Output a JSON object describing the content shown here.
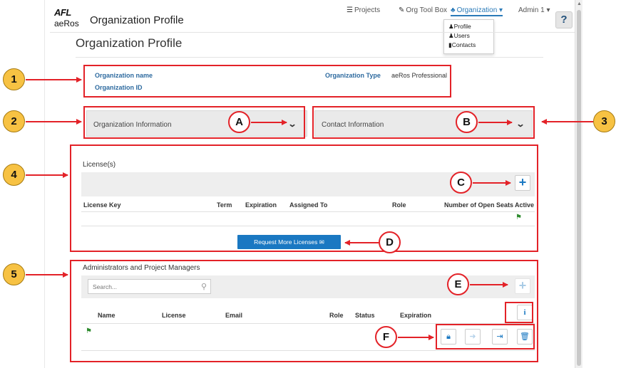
{
  "header": {
    "logo_afl": "AFL",
    "logo_aeros": "aeRos",
    "title": "Organization Profile",
    "nav": {
      "projects": "Projects",
      "org_tool_box": "Org Tool Box",
      "organization": "Organization",
      "admin": "Admin 1"
    },
    "help": "?"
  },
  "dropdown": {
    "items": [
      "Profile",
      "Users",
      "Contacts"
    ]
  },
  "page_title": "Organization Profile",
  "org": {
    "name_label": "Organization name",
    "id_label": "Organization ID",
    "type_label": "Organization Type",
    "type_value": "aeRos Professional"
  },
  "panels": {
    "org_info": "Organization Information",
    "contact_info": "Contact Information"
  },
  "licenses": {
    "label": "License(s)",
    "columns": [
      "License Key",
      "Term",
      "Expiration",
      "Assigned To",
      "Role",
      "Number of Open Seats",
      "Active"
    ],
    "request_button": "Request More Licenses"
  },
  "admins": {
    "label": "Administrators and Project Managers",
    "search_placeholder": "Search...",
    "columns": [
      "Name",
      "License",
      "Email",
      "Role",
      "Status",
      "Expiration"
    ]
  },
  "annotations": {
    "numbers": [
      "1",
      "2",
      "3",
      "4",
      "5"
    ],
    "letters": [
      "A",
      "B",
      "C",
      "D",
      "E",
      "F"
    ]
  },
  "colors": {
    "annotation_red": "#e32228",
    "circle_yellow": "#f7c243",
    "accent_blue": "#1a78c2",
    "label_blue": "#2d6a9f"
  }
}
